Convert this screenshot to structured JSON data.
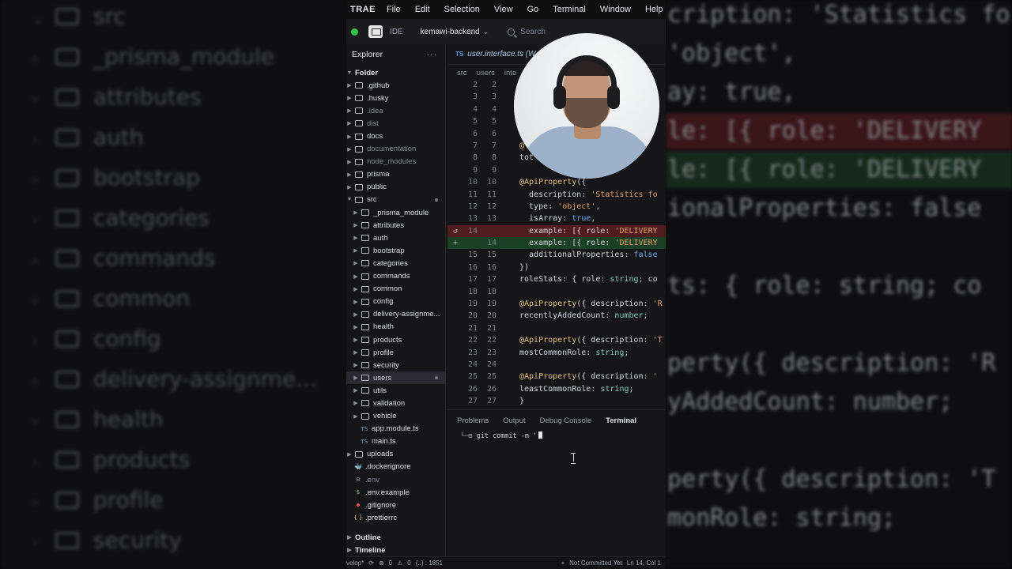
{
  "background": {
    "left_rows": [
      "src",
      "_prisma_module",
      "attributes",
      "auth",
      "bootstrap",
      "categories",
      "commands",
      "common",
      "config",
      "delivery-assignme...",
      "health",
      "products",
      "profile",
      "security"
    ],
    "right_lines": [
      {
        "text": "cription: 'Statistics fo",
        "style": "plain"
      },
      {
        "text": "  'object',",
        "style": "plain"
      },
      {
        "text": "ay: true,",
        "style": "plain"
      },
      {
        "text": "le: [{ role: 'DELIVERY",
        "style": "red"
      },
      {
        "text": "le: [{ role: 'DELIVERY",
        "style": "green"
      },
      {
        "text": "ionalProperties: false",
        "style": "plain"
      },
      {
        "text": "",
        "style": "plain"
      },
      {
        "text": "ts: { role: string; co",
        "style": "plain"
      },
      {
        "text": "",
        "style": "plain"
      },
      {
        "text": "perty({ description: 'R",
        "style": "plain"
      },
      {
        "text": "yAddedCount: number;",
        "style": "plain"
      },
      {
        "text": "",
        "style": "plain"
      },
      {
        "text": "perty({ description: 'T",
        "style": "plain"
      },
      {
        "text": "monRole: string;",
        "style": "plain"
      }
    ]
  },
  "menubar": {
    "brand": "TRAE",
    "items": [
      "File",
      "Edit",
      "Selection",
      "View",
      "Go",
      "Terminal",
      "Window",
      "Help"
    ]
  },
  "titlebar": {
    "mode": "IDE",
    "project": "kemawi-backend",
    "search_placeholder": "Search"
  },
  "explorer": {
    "title": "Explorer",
    "more": "···",
    "root": "Folder",
    "items": [
      {
        "label": ".github",
        "kind": "folder",
        "depth": 1
      },
      {
        "label": ".husky",
        "kind": "folder",
        "depth": 1
      },
      {
        "label": ".idea",
        "kind": "folder",
        "depth": 1,
        "dim": true
      },
      {
        "label": "dist",
        "kind": "folder",
        "depth": 1,
        "dim": true
      },
      {
        "label": "docs",
        "kind": "folder",
        "depth": 1
      },
      {
        "label": "documentation",
        "kind": "folder",
        "depth": 1,
        "dim": true
      },
      {
        "label": "node_modules",
        "kind": "folder",
        "depth": 1,
        "dim": true
      },
      {
        "label": "prisma",
        "kind": "folder",
        "depth": 1
      },
      {
        "label": "public",
        "kind": "folder",
        "depth": 1
      },
      {
        "label": "src",
        "kind": "folder-open",
        "depth": 1,
        "mark": true
      },
      {
        "label": "_prisma_module",
        "kind": "folder",
        "depth": 2
      },
      {
        "label": "attributes",
        "kind": "folder",
        "depth": 2
      },
      {
        "label": "auth",
        "kind": "folder",
        "depth": 2
      },
      {
        "label": "bootstrap",
        "kind": "folder",
        "depth": 2
      },
      {
        "label": "categories",
        "kind": "folder",
        "depth": 2
      },
      {
        "label": "commands",
        "kind": "folder",
        "depth": 2
      },
      {
        "label": "common",
        "kind": "folder",
        "depth": 2
      },
      {
        "label": "config",
        "kind": "folder",
        "depth": 2
      },
      {
        "label": "delivery-assignme...",
        "kind": "folder",
        "depth": 2
      },
      {
        "label": "health",
        "kind": "folder",
        "depth": 2
      },
      {
        "label": "products",
        "kind": "folder",
        "depth": 2
      },
      {
        "label": "profile",
        "kind": "folder",
        "depth": 2
      },
      {
        "label": "security",
        "kind": "folder",
        "depth": 2
      },
      {
        "label": "users",
        "kind": "folder",
        "depth": 2,
        "selected": true,
        "mark": true
      },
      {
        "label": "utils",
        "kind": "folder",
        "depth": 2
      },
      {
        "label": "validation",
        "kind": "folder",
        "depth": 2
      },
      {
        "label": "vehicle",
        "kind": "folder",
        "depth": 2
      },
      {
        "label": "app.module.ts",
        "kind": "ts",
        "depth": 2
      },
      {
        "label": "main.ts",
        "kind": "ts",
        "depth": 2
      },
      {
        "label": "uploads",
        "kind": "folder",
        "depth": 1
      },
      {
        "label": ".dockerignore",
        "kind": "docker",
        "depth": 1
      },
      {
        "label": ".env",
        "kind": "env",
        "depth": 1,
        "dim": true
      },
      {
        "label": ".env.example",
        "kind": "dollar",
        "depth": 1
      },
      {
        "label": ".gitignore",
        "kind": "git",
        "depth": 1
      },
      {
        "label": ".prettierrc",
        "kind": "json",
        "depth": 1
      }
    ],
    "footer": [
      "Outline",
      "Timeline"
    ]
  },
  "editor": {
    "tab_lang": "TS",
    "tab_name": "user.interface.ts (W",
    "breadcrumbs": [
      "src",
      "users",
      "inte"
    ],
    "lines": [
      {
        "o": "2",
        "n": "2",
        "kind": "",
        "tokens": []
      },
      {
        "o": "3",
        "n": "3",
        "kind": "",
        "tokens": [
          {
            "c": "p",
            "t": "e"
          }
        ]
      },
      {
        "o": "4",
        "n": "4",
        "kind": "",
        "tokens": []
      },
      {
        "o": "5",
        "n": "5",
        "kind": "",
        "tokens": []
      },
      {
        "o": "6",
        "n": "6",
        "kind": "",
        "tokens": []
      },
      {
        "o": "7",
        "n": "7",
        "kind": "",
        "tokens": [
          {
            "c": "f",
            "t": "@"
          }
        ]
      },
      {
        "o": "8",
        "n": "8",
        "kind": "",
        "tokens": [
          {
            "c": "k",
            "t": "tot"
          }
        ]
      },
      {
        "o": "9",
        "n": "9",
        "kind": "",
        "tokens": []
      },
      {
        "o": "10",
        "n": "10",
        "kind": "",
        "tokens": [
          {
            "c": "f",
            "t": "@ApiProperty"
          },
          {
            "c": "k",
            "t": "({"
          }
        ]
      },
      {
        "o": "11",
        "n": "11",
        "kind": "",
        "tokens": [
          {
            "c": "k",
            "t": "  description: "
          },
          {
            "c": "s",
            "t": "'Statistics fo"
          }
        ]
      },
      {
        "o": "12",
        "n": "12",
        "kind": "",
        "tokens": [
          {
            "c": "k",
            "t": "  type: "
          },
          {
            "c": "s",
            "t": "'object'"
          },
          {
            "c": "k",
            "t": ","
          }
        ]
      },
      {
        "o": "13",
        "n": "13",
        "kind": "",
        "tokens": [
          {
            "c": "k",
            "t": "  isArray: "
          },
          {
            "c": "b",
            "t": "true"
          },
          {
            "c": "k",
            "t": ","
          }
        ]
      },
      {
        "o": "14",
        "n": "",
        "kind": "del",
        "tokens": [
          {
            "c": "k",
            "t": "  example: [{ role: "
          },
          {
            "c": "s",
            "t": "'DELIVERY"
          }
        ]
      },
      {
        "o": "",
        "n": "14",
        "kind": "add",
        "tokens": [
          {
            "c": "k",
            "t": "  example: [{ role: "
          },
          {
            "c": "s",
            "t": "'DELIVERY"
          }
        ]
      },
      {
        "o": "15",
        "n": "15",
        "kind": "",
        "tokens": [
          {
            "c": "k",
            "t": "  additionalProperties: "
          },
          {
            "c": "b",
            "t": "false"
          }
        ]
      },
      {
        "o": "16",
        "n": "16",
        "kind": "",
        "tokens": [
          {
            "c": "k",
            "t": "})"
          }
        ]
      },
      {
        "o": "17",
        "n": "17",
        "kind": "",
        "tokens": [
          {
            "c": "k",
            "t": "roleStats: { role: "
          },
          {
            "c": "t",
            "t": "string"
          },
          {
            "c": "k",
            "t": "; co"
          }
        ]
      },
      {
        "o": "18",
        "n": "18",
        "kind": "",
        "tokens": []
      },
      {
        "o": "19",
        "n": "19",
        "kind": "",
        "tokens": [
          {
            "c": "f",
            "t": "@ApiProperty"
          },
          {
            "c": "k",
            "t": "({ description: "
          },
          {
            "c": "s",
            "t": "'R"
          }
        ]
      },
      {
        "o": "20",
        "n": "20",
        "kind": "",
        "tokens": [
          {
            "c": "k",
            "t": "recentlyAddedCount: "
          },
          {
            "c": "t",
            "t": "number"
          },
          {
            "c": "k",
            "t": ";"
          }
        ]
      },
      {
        "o": "21",
        "n": "21",
        "kind": "",
        "tokens": []
      },
      {
        "o": "22",
        "n": "22",
        "kind": "",
        "tokens": [
          {
            "c": "f",
            "t": "@ApiProperty"
          },
          {
            "c": "k",
            "t": "({ description: "
          },
          {
            "c": "s",
            "t": "'T"
          }
        ]
      },
      {
        "o": "23",
        "n": "23",
        "kind": "",
        "tokens": [
          {
            "c": "k",
            "t": "mostCommonRole: "
          },
          {
            "c": "t",
            "t": "string"
          },
          {
            "c": "k",
            "t": ";"
          }
        ]
      },
      {
        "o": "24",
        "n": "24",
        "kind": "",
        "tokens": []
      },
      {
        "o": "25",
        "n": "25",
        "kind": "",
        "tokens": [
          {
            "c": "f",
            "t": "@ApiProperty"
          },
          {
            "c": "k",
            "t": "({ description: "
          },
          {
            "c": "s",
            "t": "'"
          }
        ]
      },
      {
        "o": "26",
        "n": "26",
        "kind": "",
        "tokens": [
          {
            "c": "k",
            "t": "leastCommonRole: "
          },
          {
            "c": "t",
            "t": "string"
          },
          {
            "c": "k",
            "t": ";"
          }
        ]
      },
      {
        "o": "27",
        "n": "27",
        "kind": "",
        "tokens": [
          {
            "c": "k",
            "t": "}"
          }
        ]
      }
    ]
  },
  "panel": {
    "tabs": [
      "Problems",
      "Output",
      "Debug Console",
      "Terminal"
    ],
    "active_tab": "Terminal",
    "prompt": "└─⊞",
    "command": "git commit -m '"
  },
  "statusbar": {
    "branch": "velop*",
    "errors": "0",
    "warnings": "0",
    "extra": "{..} : 1851",
    "git": "Not Committed Yet",
    "position": "Ln 14, Col 1"
  }
}
